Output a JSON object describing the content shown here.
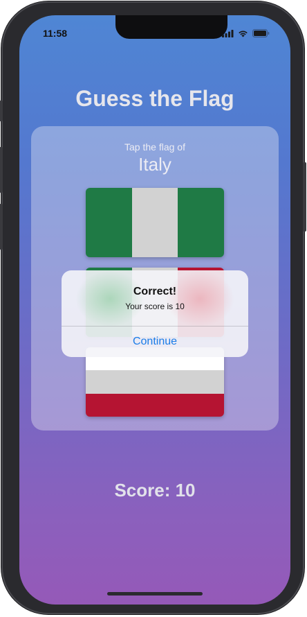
{
  "status_bar": {
    "time": "11:58",
    "icons": [
      "cellular-signal-icon",
      "wifi-icon",
      "battery-icon"
    ]
  },
  "title": "Guess the Flag",
  "prompt": {
    "label": "Tap the flag of",
    "country": "Italy"
  },
  "flags": [
    {
      "name": "nigeria-flag",
      "orientation": "vertical",
      "stripes": [
        "#1f7a45",
        "#d2d2d2",
        "#1f7a45"
      ]
    },
    {
      "name": "italy-flag",
      "orientation": "vertical",
      "stripes": [
        "#1f7a45",
        "#d2d2d2",
        "#b51432"
      ]
    },
    {
      "name": "horizontal-tricolor-flag",
      "orientation": "horizontal",
      "stripes": [
        "#ffffff",
        "#d2d2d2",
        "#b51432"
      ]
    }
  ],
  "alert": {
    "title": "Correct!",
    "message": "Your score is 10",
    "button_label": "Continue"
  },
  "score_label": "Score: 10",
  "colors": {
    "gradient_top": "#4f86d4",
    "gradient_bottom": "#9559b8",
    "alert_button": "#1a7ce8"
  }
}
